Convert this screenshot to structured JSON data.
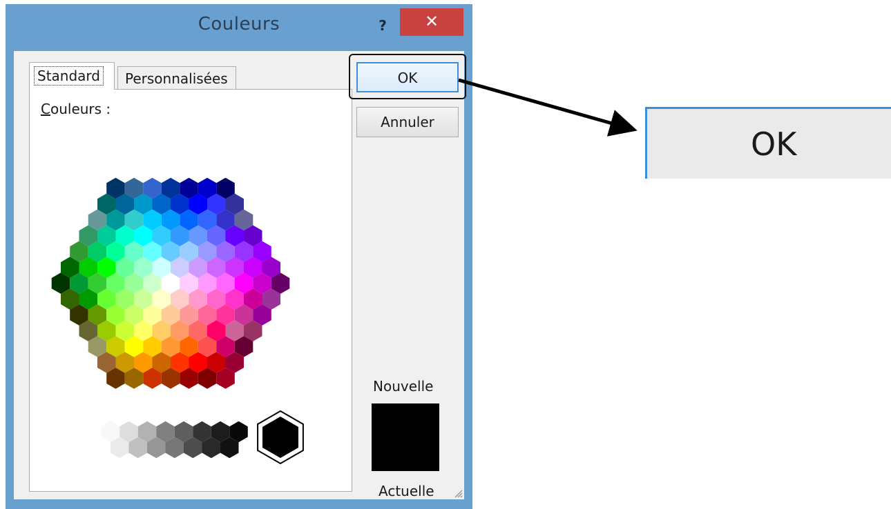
{
  "window": {
    "title": "Couleurs",
    "help": "?",
    "close": "✕"
  },
  "tabs": {
    "standard": "Standard",
    "custom": "Personnalisées"
  },
  "colors_label_first": "C",
  "colors_label_rest": "ouleurs :",
  "buttons": {
    "ok": "OK",
    "cancel": "Annuler"
  },
  "preview": {
    "new_label": "Nouvelle",
    "current_label": "Actuelle",
    "current_color": "#000000"
  },
  "zoom": {
    "label": "OK"
  },
  "accent": "#3c8ddc",
  "palette_rows": [
    [
      "#003366",
      "#336699",
      "#3366cc",
      "#003399",
      "#000099",
      "#0000cc",
      "#000066"
    ],
    [
      "#006666",
      "#006699",
      "#0099cc",
      "#0066cc",
      "#0033cc",
      "#0000ff",
      "#3333ff",
      "#333399"
    ],
    [
      "#669999",
      "#009999",
      "#33cccc",
      "#00ccff",
      "#0099ff",
      "#0066ff",
      "#3366ff",
      "#3333cc",
      "#666699"
    ],
    [
      "#339966",
      "#00cc99",
      "#00ffcc",
      "#00ffff",
      "#33ccff",
      "#3399ff",
      "#6699ff",
      "#6666ff",
      "#6600ff",
      "#6600cc"
    ],
    [
      "#339933",
      "#00cc66",
      "#00ff99",
      "#66ffcc",
      "#66ffff",
      "#66ccff",
      "#99ccff",
      "#9999ff",
      "#9966ff",
      "#9933ff",
      "#9900ff"
    ],
    [
      "#006600",
      "#00cc00",
      "#00ff00",
      "#66ff99",
      "#99ffcc",
      "#ccffff",
      "#ccccff",
      "#cc99ff",
      "#cc66ff",
      "#cc33ff",
      "#cc00ff",
      "#9900cc"
    ],
    [
      "#003300",
      "#009933",
      "#33cc33",
      "#66ff66",
      "#99ff99",
      "#ccffcc",
      "#ffffff",
      "#ffccff",
      "#ff99ff",
      "#ff66ff",
      "#ff00ff",
      "#cc00cc",
      "#660066"
    ],
    [
      "#336600",
      "#009900",
      "#66ff33",
      "#99ff66",
      "#ccff99",
      "#ffffcc",
      "#ffcccc",
      "#ff99cc",
      "#ff66cc",
      "#ff33cc",
      "#cc0099",
      "#993399"
    ],
    [
      "#333300",
      "#669900",
      "#99ff33",
      "#ccff66",
      "#ffff99",
      "#ffcc99",
      "#ff9999",
      "#ff6699",
      "#ff3399",
      "#cc3399",
      "#990099"
    ],
    [
      "#666633",
      "#99cc00",
      "#ccff33",
      "#ffff66",
      "#ffcc66",
      "#ff9966",
      "#ff6666",
      "#ff0066",
      "#cc6699",
      "#993366"
    ],
    [
      "#999966",
      "#cccc00",
      "#ffff00",
      "#ffcc00",
      "#ff9933",
      "#ff6600",
      "#ff5050",
      "#cc0066",
      "#660033"
    ],
    [
      "#996633",
      "#cc9900",
      "#ff9900",
      "#cc6600",
      "#ff3300",
      "#ff0000",
      "#cc0000",
      "#990033"
    ],
    [
      "#663300",
      "#996600",
      "#cc3300",
      "#993300",
      "#990000",
      "#800000",
      "#a50021"
    ]
  ],
  "gray_rows": [
    [
      "#f8f8f8",
      "#dddddd",
      "#b2b2b2",
      "#808080",
      "#5f5f5f",
      "#333333",
      "#1c1c1c",
      "#080808"
    ],
    [
      "#eaeaea",
      "#c0c0c0",
      "#969696",
      "#777777",
      "#4d4d4d",
      "#292929",
      "#111111"
    ]
  ],
  "selected_color": "#000000"
}
